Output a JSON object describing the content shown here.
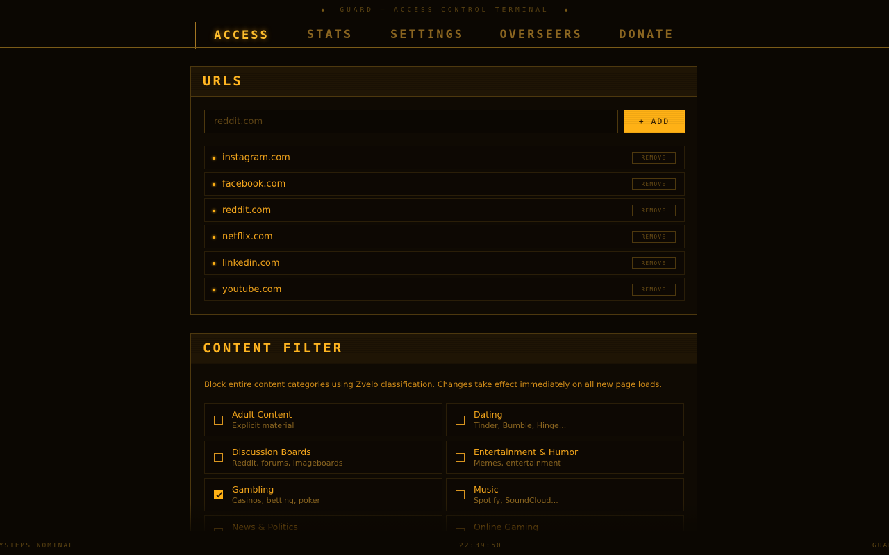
{
  "app": {
    "header": "GUARD — ACCESS CONTROL TERMINAL"
  },
  "tabs": [
    {
      "label": "ACCESS",
      "active": true
    },
    {
      "label": "STATS",
      "active": false
    },
    {
      "label": "SETTINGS",
      "active": false
    },
    {
      "label": "OVERSEERS",
      "active": false
    },
    {
      "label": "DONATE",
      "active": false
    }
  ],
  "urls_panel": {
    "title": "URLS",
    "input_placeholder": "reddit.com",
    "add_label": "+ ADD",
    "remove_label": "REMOVE",
    "items": [
      "instagram.com",
      "facebook.com",
      "reddit.com",
      "netflix.com",
      "linkedin.com",
      "youtube.com"
    ]
  },
  "content_filter": {
    "title": "CONTENT FILTER",
    "description": "Block entire content categories using Zvelo classification. Changes take effect immediately on all new page loads.",
    "categories": [
      {
        "name": "Adult Content",
        "sub": "Explicit material",
        "checked": false
      },
      {
        "name": "Dating",
        "sub": "Tinder, Bumble, Hinge...",
        "checked": false
      },
      {
        "name": "Discussion Boards",
        "sub": "Reddit, forums, imageboards",
        "checked": false
      },
      {
        "name": "Entertainment & Humor",
        "sub": "Memes, entertainment",
        "checked": false
      },
      {
        "name": "Gambling",
        "sub": "Casinos, betting, poker",
        "checked": true
      },
      {
        "name": "Music",
        "sub": "Spotify, SoundCloud...",
        "checked": false
      },
      {
        "name": "News & Politics",
        "sub": "",
        "checked": false
      },
      {
        "name": "Online Gaming",
        "sub": "",
        "checked": false
      }
    ]
  },
  "status": {
    "left": "SYSTEMS NOMINAL",
    "time": "22:39:50",
    "right": "GUARD"
  },
  "colors": {
    "accent": "#ffb115",
    "background": "#0b0702",
    "border": "#4d380e"
  }
}
